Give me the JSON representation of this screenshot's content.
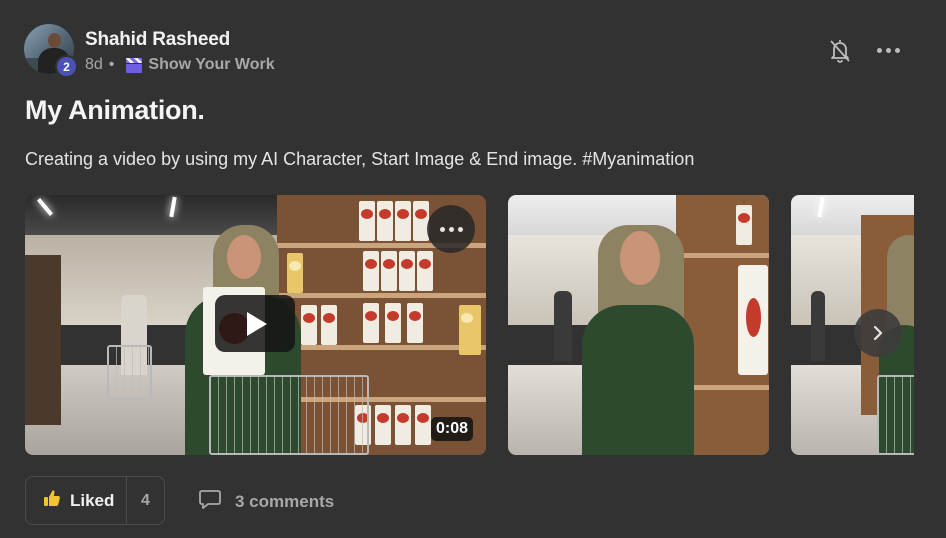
{
  "post": {
    "author": "Shahid Rasheed",
    "level": "2",
    "age": "8d",
    "separator": "•",
    "category": "Show Your Work",
    "title": "My Animation.",
    "body": "Creating a video by using my AI Character, Start Image & End image. #Myanimation"
  },
  "media": {
    "video_duration": "0:08"
  },
  "actions": {
    "like_label": "Liked",
    "like_count": "4",
    "comments_label": "3 comments"
  },
  "icons": {
    "bell": "bell-off-icon",
    "more": "more-horizontal-icon",
    "play": "play-icon",
    "next": "chevron-right-icon",
    "like": "thumbs-up-icon",
    "comment": "comment-icon",
    "category": "clapperboard-icon"
  },
  "colors": {
    "background": "#323232",
    "level_badge": "#4a52b8",
    "like_icon": "#f1c232",
    "muted_text": "#a8a8a8"
  }
}
